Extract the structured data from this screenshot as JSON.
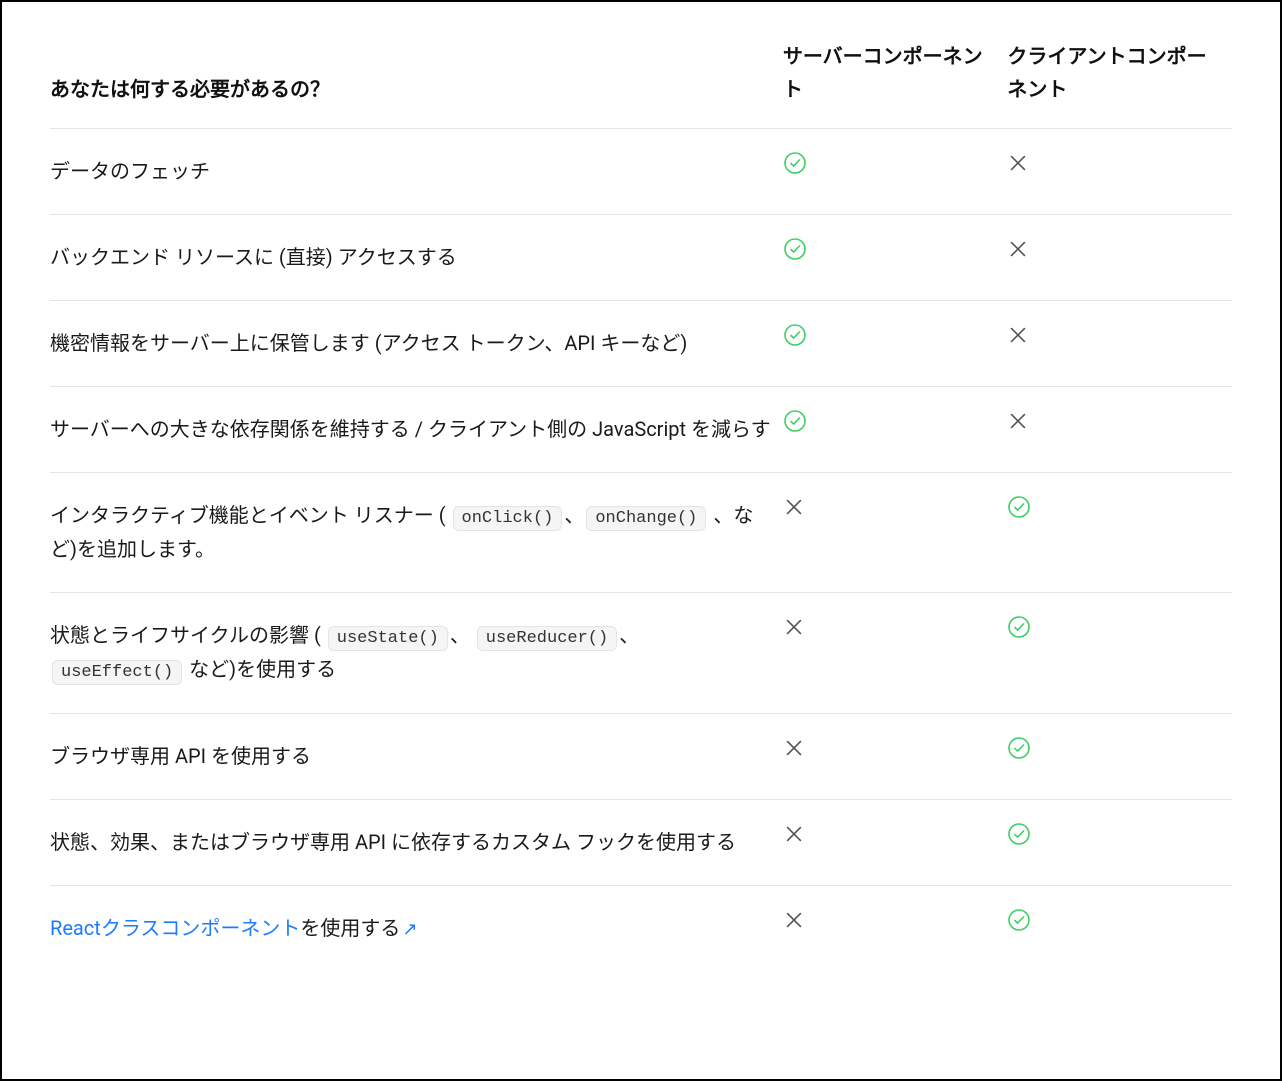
{
  "headers": {
    "need": "あなたは何する必要があるの？",
    "server": "サーバーコンポーネント",
    "client": "クライアントコンポーネント"
  },
  "rows": [
    {
      "need": {
        "type": "plain",
        "parts": [
          {
            "t": "text",
            "v": "データのフェッチ"
          }
        ]
      },
      "server": "check",
      "client": "cross"
    },
    {
      "need": {
        "type": "plain",
        "parts": [
          {
            "t": "text",
            "v": "バックエンド リソースに (直接) アクセスする"
          }
        ]
      },
      "server": "check",
      "client": "cross"
    },
    {
      "need": {
        "type": "plain",
        "parts": [
          {
            "t": "text",
            "v": "機密情報をサーバー上に保管します (アクセス トークン、API キーなど)"
          }
        ]
      },
      "server": "check",
      "client": "cross"
    },
    {
      "need": {
        "type": "plain",
        "parts": [
          {
            "t": "text",
            "v": "サーバーへの大きな依存関係を維持する / クライアント側の JavaScript を減らす"
          }
        ]
      },
      "server": "check",
      "client": "cross"
    },
    {
      "need": {
        "type": "plain",
        "parts": [
          {
            "t": "text",
            "v": "インタラクティブ機能とイベント リスナー ( "
          },
          {
            "t": "code",
            "v": "onClick()"
          },
          {
            "t": "text",
            "v": "、"
          },
          {
            "t": "code",
            "v": "onChange()"
          },
          {
            "t": "text",
            "v": " 、など)を追加します。"
          }
        ]
      },
      "server": "cross",
      "client": "check"
    },
    {
      "need": {
        "type": "plain",
        "parts": [
          {
            "t": "text",
            "v": "状態とライフサイクルの影響 ( "
          },
          {
            "t": "code",
            "v": "useState()"
          },
          {
            "t": "text",
            "v": "、 "
          },
          {
            "t": "code",
            "v": "useReducer()"
          },
          {
            "t": "text",
            "v": "、 "
          },
          {
            "t": "code",
            "v": "useEffect()"
          },
          {
            "t": "text",
            "v": " など)を使用する"
          }
        ]
      },
      "server": "cross",
      "client": "check"
    },
    {
      "need": {
        "type": "plain",
        "parts": [
          {
            "t": "text",
            "v": "ブラウザ専用 API を使用する"
          }
        ]
      },
      "server": "cross",
      "client": "check"
    },
    {
      "need": {
        "type": "plain",
        "parts": [
          {
            "t": "text",
            "v": "状態、効果、またはブラウザ専用 API に依存するカスタム フックを使用する"
          }
        ]
      },
      "server": "cross",
      "client": "check"
    },
    {
      "need": {
        "type": "link",
        "parts": [
          {
            "t": "link",
            "v": "Reactクラスコンポーネント"
          },
          {
            "t": "text",
            "v": "を使用する"
          },
          {
            "t": "ext",
            "v": "↗"
          }
        ]
      },
      "server": "cross",
      "client": "check"
    }
  ],
  "icons": {
    "check": "check-circle",
    "cross": "x-mark"
  },
  "colors": {
    "check_stroke": "#3ecf63",
    "cross_stroke": "#555555",
    "link": "#1d7bff",
    "border": "#e5e5e5"
  }
}
